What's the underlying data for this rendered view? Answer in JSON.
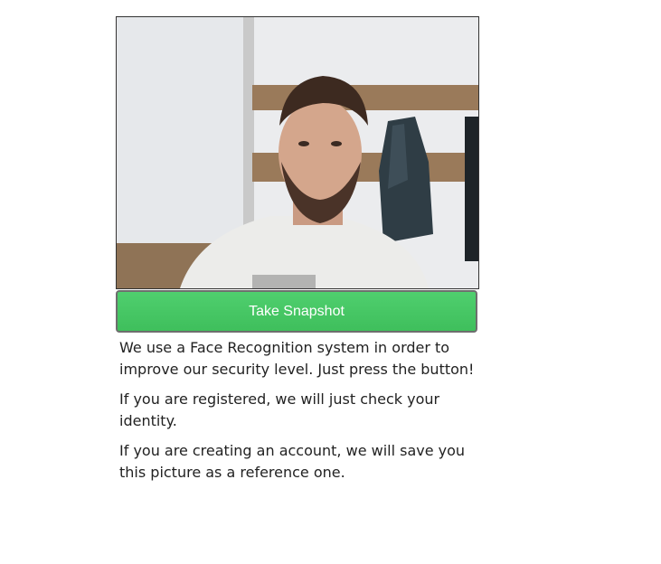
{
  "webcam": {
    "feed_description": "camera-feed"
  },
  "snapshot_button": {
    "label": "Take Snapshot"
  },
  "info": {
    "paragraphs": [
      "We use a Face Recognition system in order to improve our security level. Just press the button!",
      "If you are registered, we will just check your identity.",
      "If you are creating an account, we will save you this picture as a reference one."
    ]
  },
  "colors": {
    "button_green": "#44c765",
    "button_border": "#6e6e6e",
    "text": "#222222"
  }
}
